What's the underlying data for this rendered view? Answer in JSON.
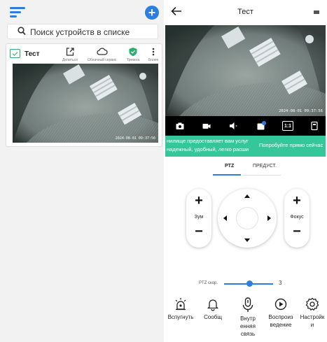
{
  "left": {
    "search": {
      "placeholder": "Поиск устройств в списке"
    },
    "device": {
      "name": "Тест",
      "actions": [
        {
          "label": "Делиться",
          "icon": "share-icon"
        },
        {
          "label": "Облачный сервис",
          "icon": "cloud-icon"
        },
        {
          "label": "Тревога",
          "icon": "shield-icon"
        },
        {
          "label": "Более",
          "icon": "more-icon"
        }
      ],
      "osd_time": "2024-08-01 09:37:56"
    }
  },
  "right": {
    "title": "Тест",
    "osd_time": "2024-08-01 09:37:56",
    "toolbar_icons": [
      "camera-icon",
      "record-icon",
      "speaker-icon",
      "hd-icon",
      "ratio-icon",
      "more-icon"
    ],
    "toolbar_ratio_label": "1:1",
    "banner": {
      "line1": "нилище предоставляет вам услуг",
      "line2": "надежный, удобный, легко расши",
      "cta": "Попробуйте прямо сейчас"
    },
    "tabs": [
      {
        "label": "PTZ",
        "active": true
      },
      {
        "label": "ПРЕДУСТ.",
        "active": false
      }
    ],
    "zoom": {
      "plus": "+",
      "label": "Зум",
      "minus": "−"
    },
    "focus": {
      "plus": "+",
      "label": "Фокус",
      "minus": "−"
    },
    "speed": {
      "label": "PTZ скор.",
      "value": "3",
      "fraction": 0.47
    },
    "bottom": [
      {
        "label": "Вспугнуть",
        "icon": "alarm-light-icon"
      },
      {
        "label": "Сообщ",
        "icon": "bell-icon"
      },
      {
        "label": "Внутр енняя связь",
        "icon": "microphone-icon"
      },
      {
        "label": "Воспроиз ведение",
        "icon": "playback-icon"
      },
      {
        "label": "Настройк и",
        "icon": "gear-icon"
      }
    ]
  },
  "colors": {
    "accent": "#2c7fe0",
    "banner": "#35c79a",
    "device_icon": "#2eae6e"
  }
}
